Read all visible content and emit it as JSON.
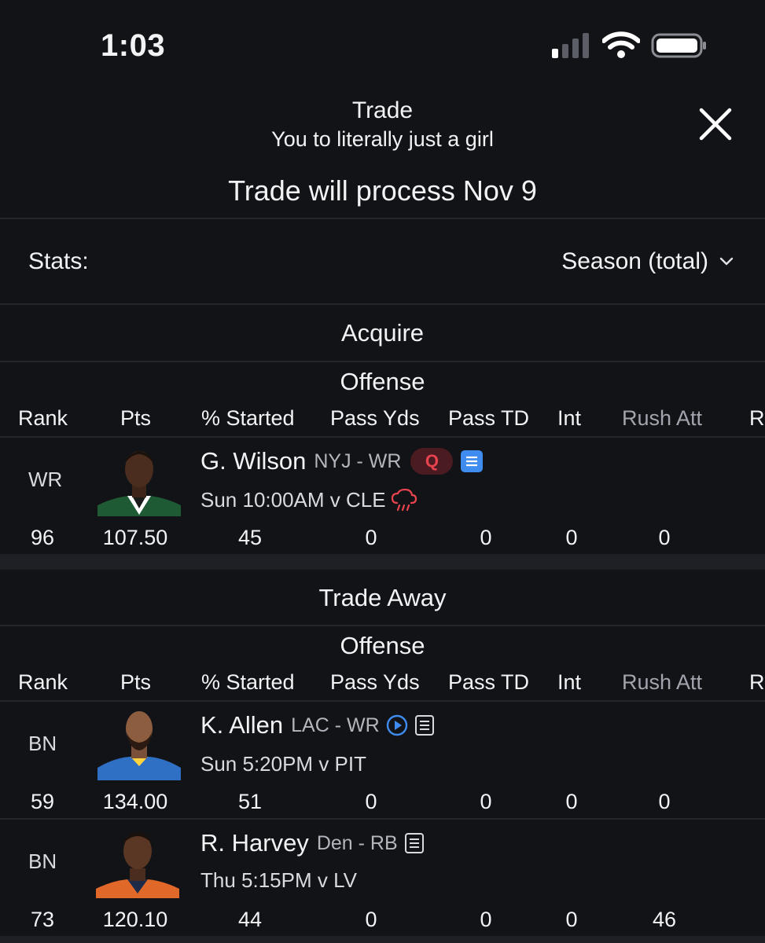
{
  "status_bar": {
    "time": "1:03"
  },
  "header": {
    "title": "Trade",
    "subtitle": "You to literally just a girl",
    "process_text": "Trade will process Nov 9"
  },
  "stats": {
    "label": "Stats:",
    "value": "Season (total)"
  },
  "columns": [
    "Rank",
    "Pts",
    "% Started",
    "Pass Yds",
    "Pass TD",
    "Int",
    "Rush Att",
    "Ru"
  ],
  "acquire": {
    "title": "Acquire",
    "group": "Offense",
    "players": [
      {
        "pos": "WR",
        "name": "G. Wilson",
        "team_pos": "NYJ - WR",
        "status": "Q",
        "game": "Sun 10:00AM v CLE",
        "rank": "96",
        "pts": "107.50",
        "started": "45",
        "pass_yds": "0",
        "pass_td": "0",
        "int": "0",
        "rush_att": "0"
      }
    ]
  },
  "trade_away": {
    "title": "Trade Away",
    "group": "Offense",
    "players": [
      {
        "pos": "BN",
        "name": "K. Allen",
        "team_pos": "LAC - WR",
        "game": "Sun 5:20PM v PIT",
        "rank": "59",
        "pts": "134.00",
        "started": "51",
        "pass_yds": "0",
        "pass_td": "0",
        "int": "0",
        "rush_att": "0"
      },
      {
        "pos": "BN",
        "name": "R. Harvey",
        "team_pos": "Den - RB",
        "game": "Thu 5:15PM v LV",
        "rank": "73",
        "pts": "120.10",
        "started": "44",
        "pass_yds": "0",
        "pass_td": "0",
        "int": "0",
        "rush_att": "46"
      }
    ]
  },
  "colors": {
    "background": "#121317",
    "q_badge": "#e8434f",
    "note_blue": "#3f8cf0",
    "muted": "#a2a5ad"
  },
  "icons": [
    "close-icon",
    "chevron-down-icon",
    "news-note-icon",
    "play-icon",
    "rain-icon",
    "signal-icon",
    "wifi-icon",
    "battery-icon"
  ]
}
